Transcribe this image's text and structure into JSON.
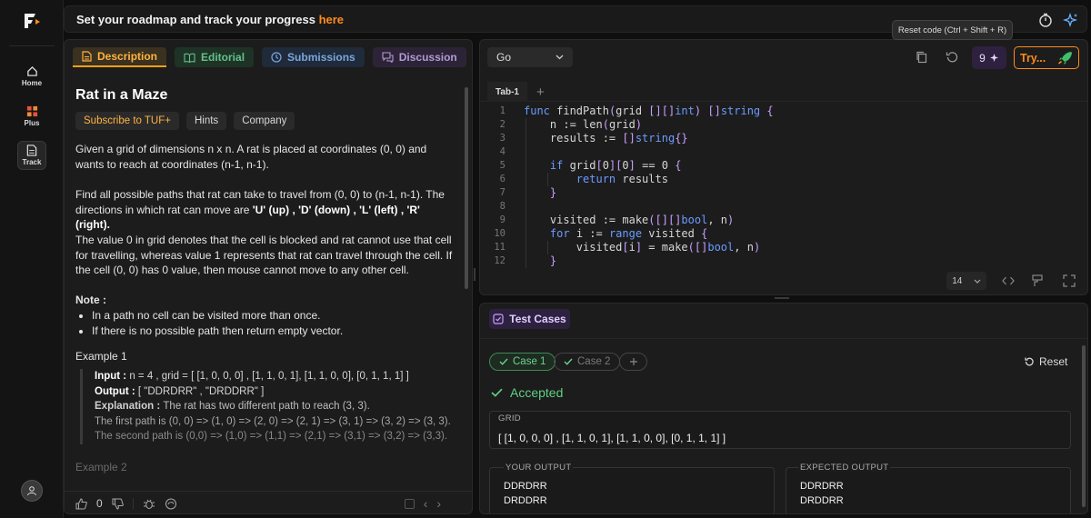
{
  "banner": {
    "text": "Set your roadmap and track your progress ",
    "link": "here"
  },
  "tooltip": "Reset code (Ctrl + Shift + R)",
  "sidebar": {
    "items": [
      {
        "label": "Home",
        "icon": "home-icon"
      },
      {
        "label": "Plus",
        "icon": "plus-grid-icon"
      },
      {
        "label": "Track",
        "icon": "track-doc-icon"
      }
    ]
  },
  "tabs": [
    "Description",
    "Editorial",
    "Submissions",
    "Discussion"
  ],
  "problem": {
    "title": "Rat in a Maze",
    "chips": [
      "Subscribe to TUF+",
      "Hints",
      "Company"
    ],
    "p1": "Given a grid of dimensions n x n. A rat is placed at coordinates (0, 0) and wants to reach at coordinates (n-1, n-1).",
    "p2a": "Find all possible paths that rat can take to travel from (0, 0) to (n-1, n-1). The directions in which rat can move are ",
    "p2b": "'U' (up) , 'D' (down) , 'L' (left) , 'R' (right).",
    "p3": "The value 0 in grid denotes that the cell is blocked and rat cannot use that cell for travelling, whereas value 1 represents that rat can travel through the cell. If the cell (0, 0) has 0 value, then mouse cannot move to any other cell.",
    "note_title": "Note :",
    "notes": [
      "In a path no cell can be visited more than once.",
      "If there is no possible path then return empty vector."
    ],
    "example1_title": "Example 1",
    "ex_input_label": "Input : ",
    "ex_input": "n = 4 , grid = [ [1, 0, 0, 0] , [1, 1, 0, 1], [1, 1, 0, 0], [0, 1, 1, 1] ]",
    "ex_output_label": "Output : ",
    "ex_output": "[ \"DDRDRR\" , \"DRDDRR\" ]",
    "ex_expl_label": "Explanation : ",
    "ex_expl": "The rat has two different path to reach (3, 3).",
    "ex_path1": "The first path is (0, 0) => (1, 0) => (2, 0) => (2, 1) => (3, 1) => (3, 2) => (3, 3).",
    "ex_path2": "The second path is (0,0) => (1,0) => (1,1) => (2,1) => (3,1) => (3,2) => (3,3).",
    "example2_title": "Example 2"
  },
  "footer": {
    "likes": "0"
  },
  "editor": {
    "language": "Go",
    "badge_count": "9",
    "try_label": "Try...",
    "file_tab": "Tab-1",
    "font_size": "14",
    "code_lines": [
      {
        "n": "1"
      },
      {
        "n": "2"
      },
      {
        "n": "3"
      },
      {
        "n": "4"
      },
      {
        "n": "5"
      },
      {
        "n": "6"
      },
      {
        "n": "7"
      },
      {
        "n": "8"
      },
      {
        "n": "9"
      },
      {
        "n": "10"
      },
      {
        "n": "11"
      },
      {
        "n": "12"
      }
    ]
  },
  "tests": {
    "tab_label": "Test Cases",
    "case1": "Case 1",
    "case2": "Case 2",
    "reset": "Reset",
    "status": "Accepted",
    "grid_label": "GRID",
    "grid_value": "[ [1, 0, 0, 0] , [1, 1, 0, 1], [1, 1, 0, 0], [0, 1, 1, 1] ]",
    "your_output_label": "YOUR OUTPUT",
    "expected_output_label": "EXPECTED OUTPUT",
    "your_output": [
      "DDRDRR",
      "DRDDRR"
    ],
    "expected_output": [
      "DDRDRR",
      "DRDDRR"
    ]
  },
  "colors": {
    "accent": "#ff8c1a",
    "success": "#5fcf83",
    "purple": "#2e2140"
  }
}
